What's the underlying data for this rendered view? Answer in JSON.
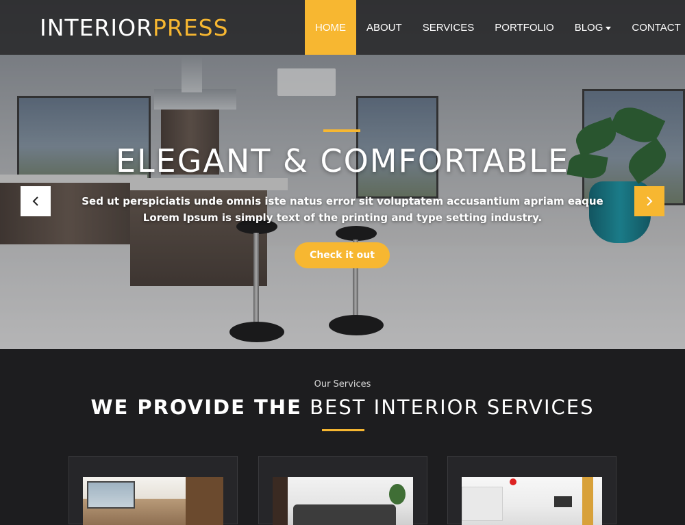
{
  "header": {
    "logo_part1": "INTERIOR",
    "logo_part2": "PRESS",
    "nav": [
      {
        "label": "HOME",
        "active": true
      },
      {
        "label": "ABOUT",
        "active": false
      },
      {
        "label": "SERVICES",
        "active": false
      },
      {
        "label": "PORTFOLIO",
        "active": false
      },
      {
        "label": "BLOG",
        "active": false,
        "has_dropdown": true
      },
      {
        "label": "CONTACT",
        "active": false
      }
    ]
  },
  "hero": {
    "title": "ELEGANT & COMFORTABLE",
    "text_line1": "Sed ut perspiciatis unde omnis iste natus error sit voluptatem accusantium apriam eaque",
    "text_line2": "Lorem Ipsum is simply text of the printing and type setting industry.",
    "cta_label": "Check it out",
    "prev_icon": "chevron-left-icon",
    "next_icon": "chevron-right-icon"
  },
  "services": {
    "subtitle": "Our Services",
    "title_strong": "WE PROVIDE THE",
    "title_rest": "BEST INTERIOR SERVICES",
    "cards": [
      {
        "image": "living-room-photo"
      },
      {
        "image": "sofa-lounge-photo"
      },
      {
        "image": "kitchen-dining-photo"
      }
    ]
  },
  "colors": {
    "accent": "#f7b731",
    "header_bg": "#232325",
    "section_bg": "#1d1d1f"
  }
}
